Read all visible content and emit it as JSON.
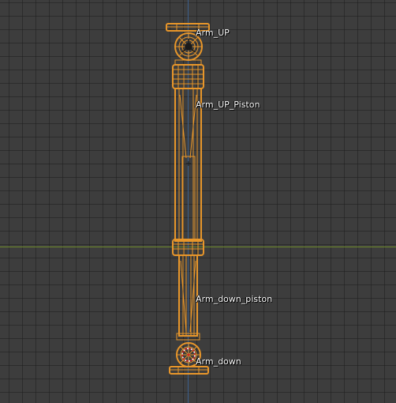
{
  "viewport": {
    "background_color": "#3d3d3d",
    "grid_color": "#2b2b2b",
    "x_axis_color": "#6e8a2c",
    "z_axis_color": "#3c5f8c",
    "selection_color": "#e8962a"
  },
  "objects": [
    {
      "name": "Arm_UP"
    },
    {
      "name": "Arm_UP_Piston"
    },
    {
      "name": "Arm_down_piston"
    },
    {
      "name": "Arm_down"
    }
  ]
}
